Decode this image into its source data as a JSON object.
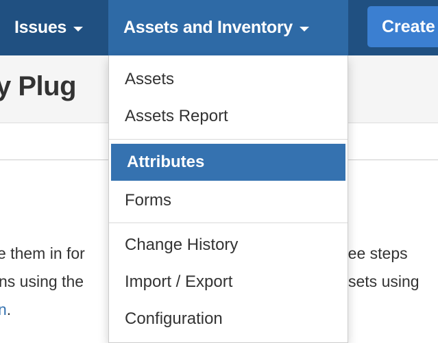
{
  "navbar": {
    "issues_label": "Issues",
    "assets_label": "Assets and Inventory",
    "create_label": "Create",
    "bg_color": "#205081",
    "active_color": "#2e6aa6",
    "create_color": "#3b7fd1"
  },
  "page": {
    "title_fragment": "y Plug",
    "lines": [
      {
        "left": "e them in for",
        "right": "ree steps"
      },
      {
        "left": "ns using the",
        "right": "sets using"
      },
      {
        "left_link": "n",
        "left_tail": "."
      }
    ]
  },
  "dropdown": {
    "group1": [
      {
        "label": "Assets"
      },
      {
        "label": "Assets Report"
      }
    ],
    "group2": [
      {
        "label": "Attributes",
        "active": true
      },
      {
        "label": "Forms"
      }
    ],
    "group3": [
      {
        "label": "Change History"
      },
      {
        "label": "Import / Export"
      },
      {
        "label": "Configuration"
      }
    ],
    "active_color": "#3572b0"
  },
  "icons": {
    "issues_caret": "chevron-down-icon",
    "assets_caret": "chevron-down-icon"
  }
}
